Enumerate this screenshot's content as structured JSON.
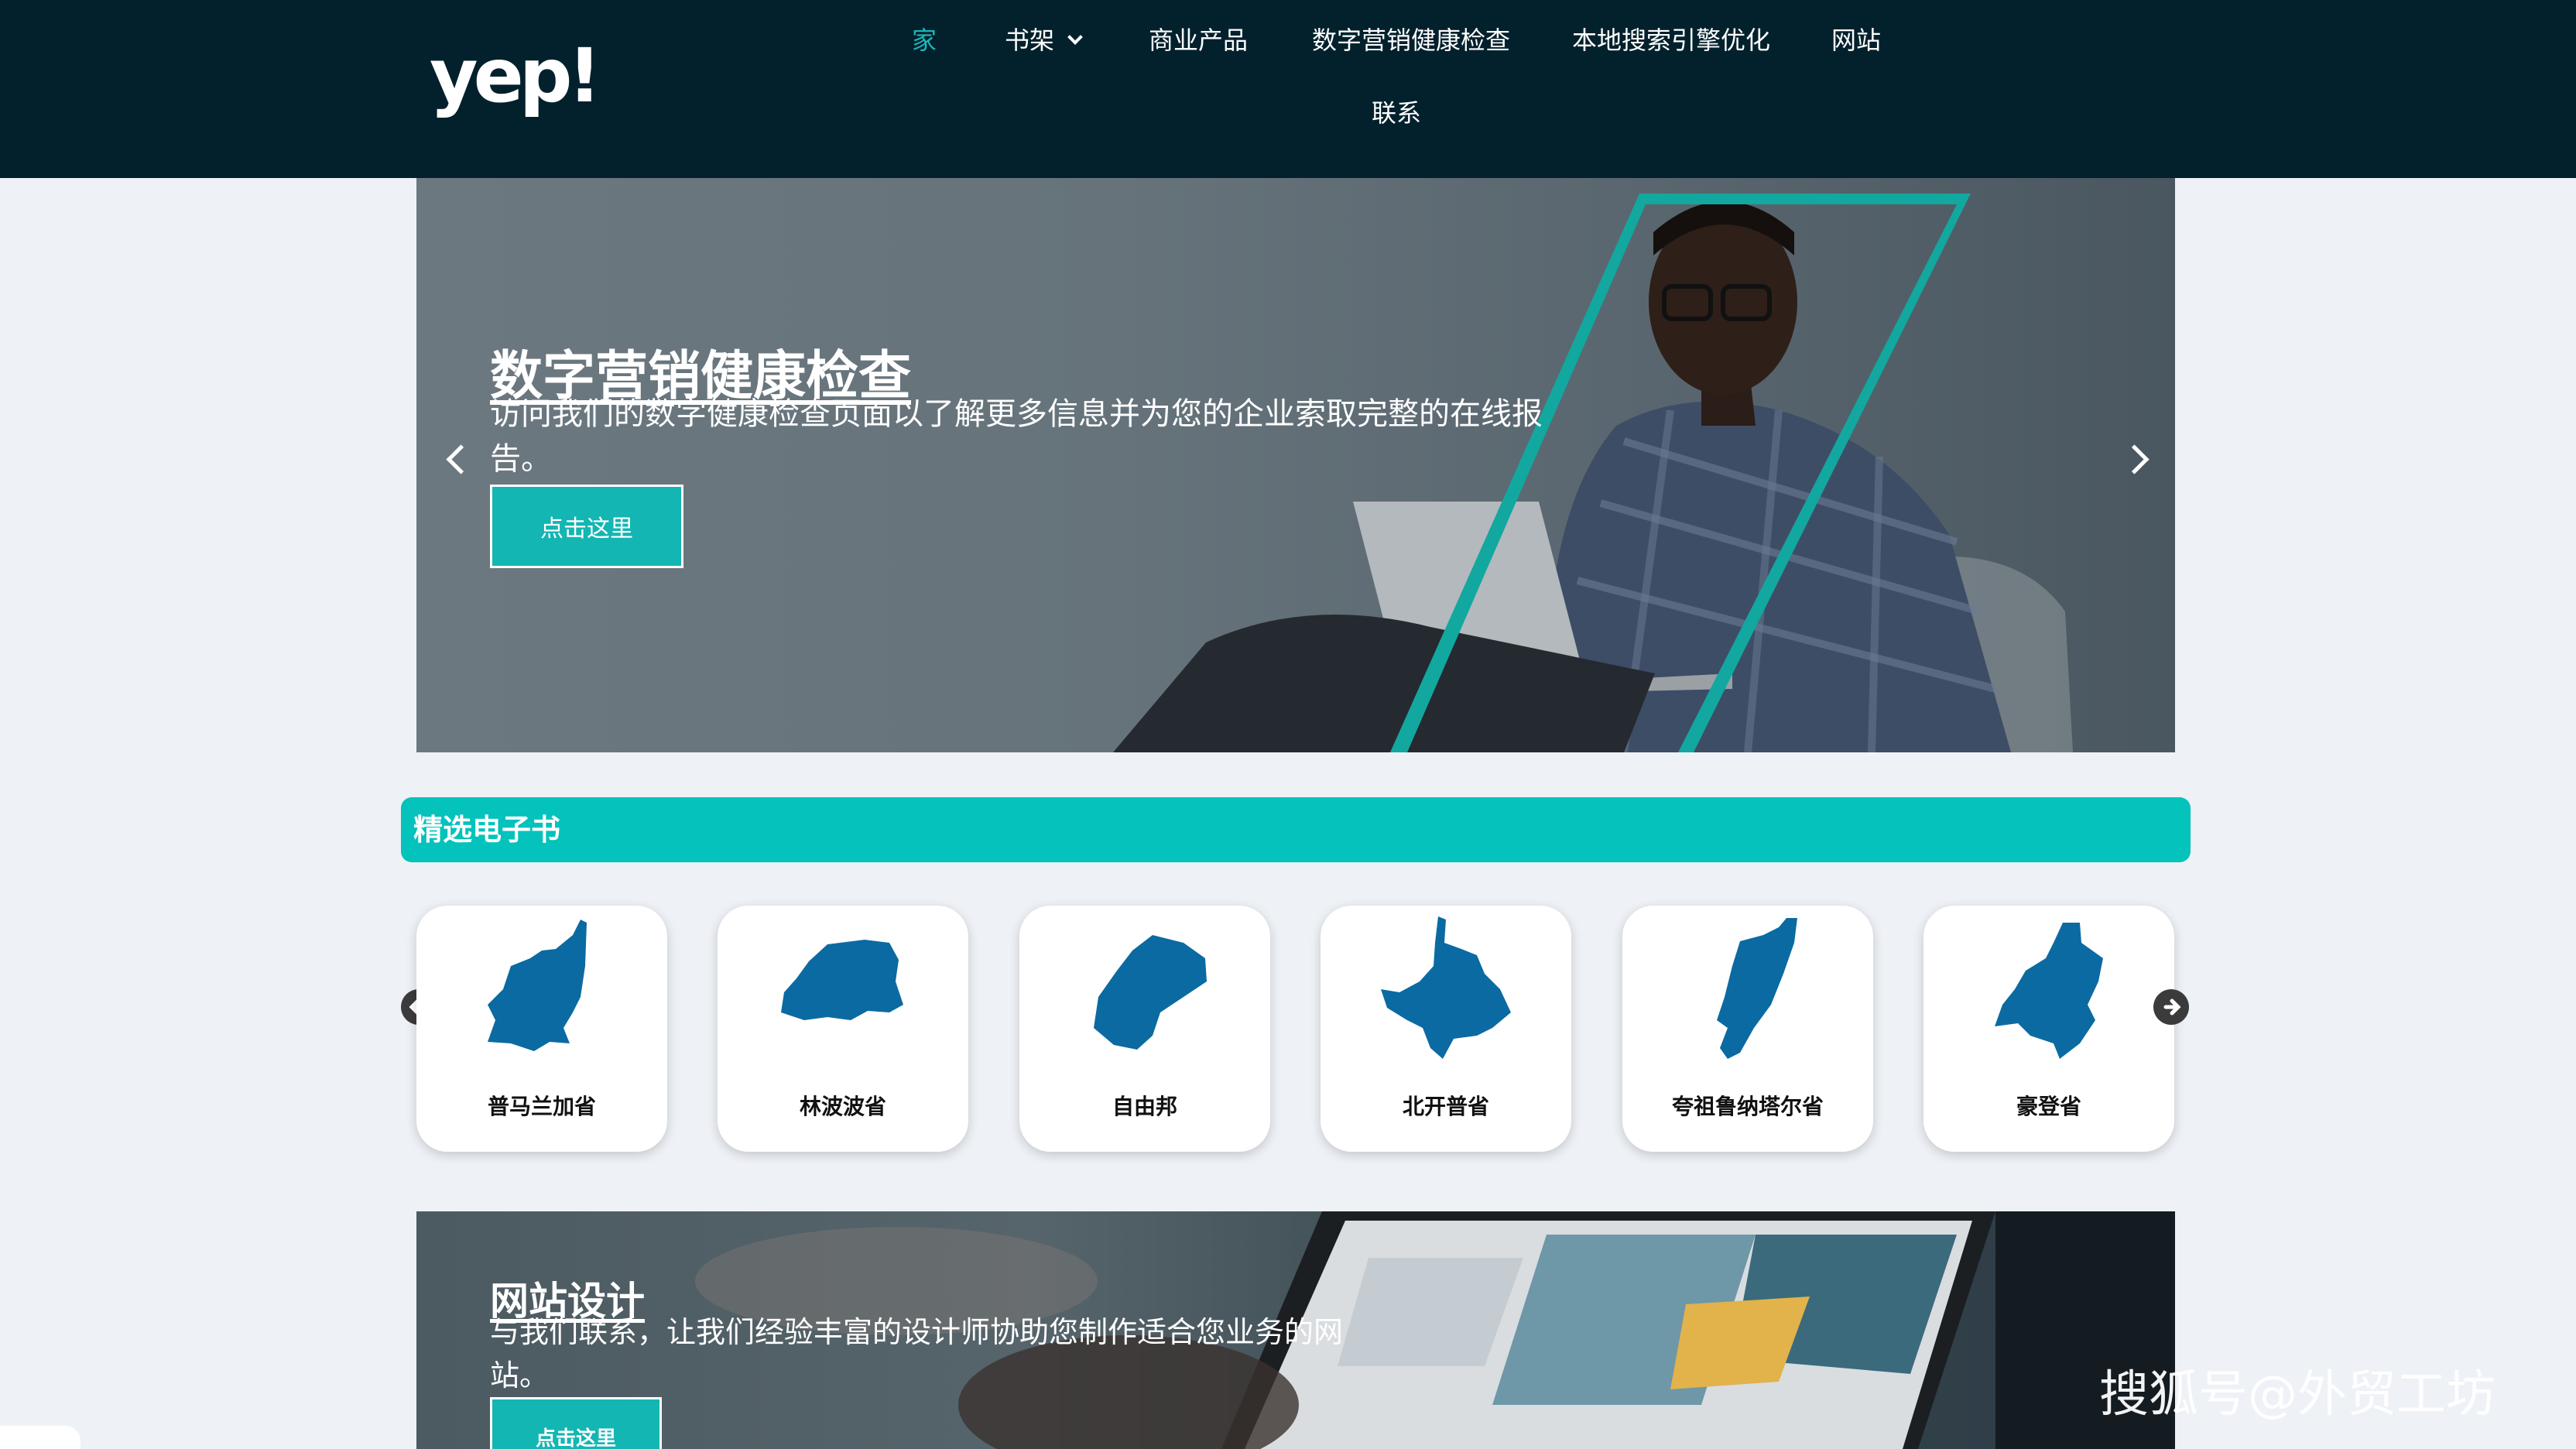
{
  "header": {
    "logo": "yep!",
    "nav": [
      {
        "label": "家",
        "active": true
      },
      {
        "label": "书架",
        "dropdown": true
      },
      {
        "label": "商业产品"
      },
      {
        "label": "数字营销健康检查"
      },
      {
        "label": "本地搜索引擎优化"
      },
      {
        "label": "网站"
      },
      {
        "label": "联系"
      }
    ]
  },
  "hero": {
    "title": "数字营销健康检查",
    "description": "访问我们的数字健康检查页面以了解更多信息并为您的企业索取完整的在线报告。",
    "button": "点击这里",
    "prev_icon": "chevron-left-icon",
    "next_icon": "chevron-right-icon"
  },
  "section": {
    "title": "精选电子书"
  },
  "provinces": [
    {
      "name": "普马兰加省"
    },
    {
      "name": "林波波省"
    },
    {
      "name": "自由邦"
    },
    {
      "name": "北开普省"
    },
    {
      "name": "夸祖鲁纳塔尔省"
    },
    {
      "name": "豪登省"
    }
  ],
  "banner2": {
    "title": "网站设计",
    "description": "与我们联系，让我们经验丰富的设计师协助您制作适合您业务的网站。",
    "button": "点击这里"
  },
  "watermark": "搜狐号@外贸工坊",
  "colors": {
    "header_bg": "#03212d",
    "accent": "#04c2bc",
    "map_blue": "#0b6aa2"
  }
}
